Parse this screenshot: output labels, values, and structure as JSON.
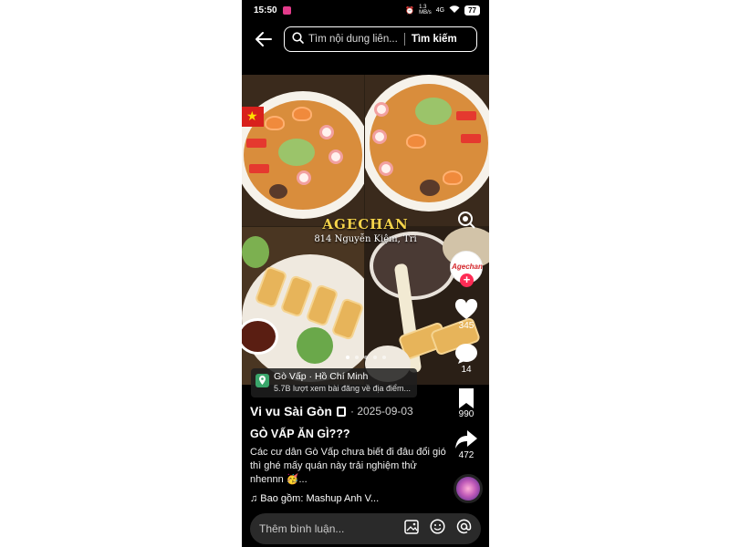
{
  "status_bar": {
    "time": "15:50",
    "network_speed": "1.3\nMB/s",
    "signal_label": "4G",
    "battery": "77"
  },
  "search": {
    "placeholder": "Tìm nội dung liên...",
    "submit_label": "Tìm kiếm"
  },
  "post_image": {
    "brand": "AGECHAN",
    "address": "814 Nguyễn Kiệm, Tri",
    "pager_count": 5,
    "pager_active": 1
  },
  "location": {
    "place": "Gò Vấp · Hồ Chí Minh",
    "views": "5.7B lượt xem bài đăng về địa điểm..."
  },
  "actions": {
    "avatar_text": "Agechan",
    "follow_symbol": "+",
    "likes": "345",
    "comments": "14",
    "saves": "990",
    "shares": "472"
  },
  "caption": {
    "author": "Vi vu Sài Gòn",
    "date": "· 2025-09-03",
    "headline": "GÒ VẤP ĂN GÌ???",
    "description": "Các cư dân Gò Vấp chưa biết đi đâu đổi gió thì ghé mấy quán này trải nghiệm thử nhennn 🥳...",
    "sound": "♫ Bao gồm: Mashup Anh V..."
  },
  "comment_bar": {
    "placeholder": "Thêm bình luận..."
  },
  "colors": {
    "background": "#000000",
    "accent": "#fe2c55",
    "brand_text": "#f4d34b",
    "location_pin": "#3aa66b"
  }
}
